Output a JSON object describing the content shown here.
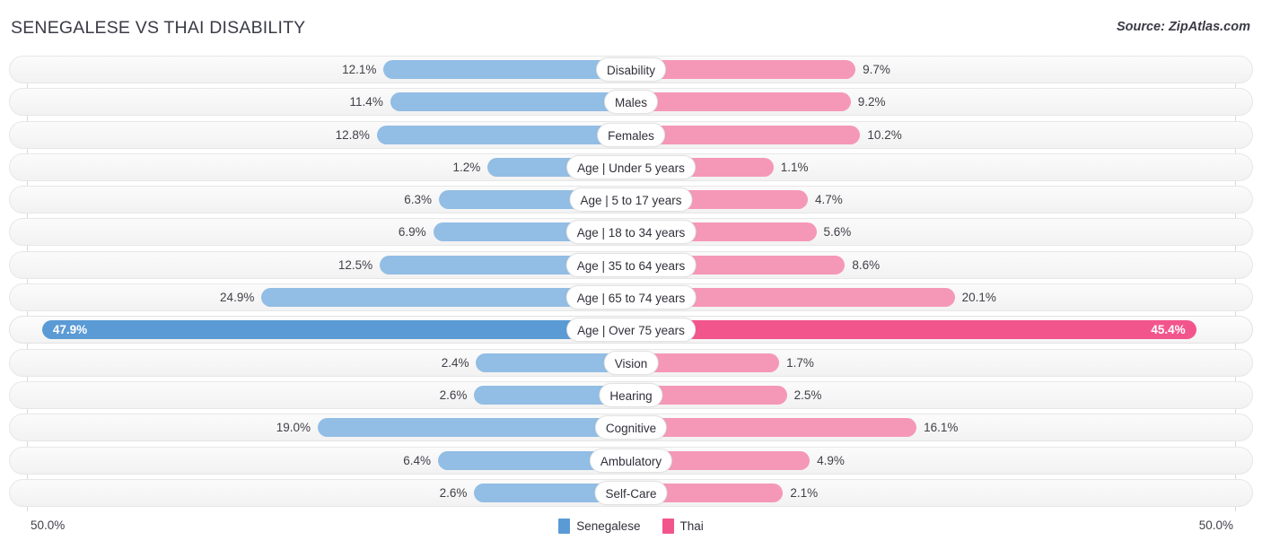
{
  "header": {
    "title": "SENEGALESE VS THAI DISABILITY",
    "source": "Source: ZipAtlas.com"
  },
  "axis": {
    "left_max_label": "50.0%",
    "right_max_label": "50.0%",
    "max_value": 50.0
  },
  "legend": {
    "items": [
      {
        "label": "Senegalese",
        "color": "#5B9BD5"
      },
      {
        "label": "Thai",
        "color": "#F2558C"
      }
    ]
  },
  "colors": {
    "left_bar": "#92BDE4",
    "right_bar": "#F598B8",
    "left_bar_highlight": "#5B9BD5",
    "right_bar_highlight": "#F2558C",
    "row_background": "#F7F7F7",
    "gridline": "#D9D9DE",
    "text": "#3F3F48"
  },
  "chart_data": {
    "type": "bar",
    "orientation": "horizontal-diverging",
    "title": "SENEGALESE VS THAI DISABILITY",
    "xlabel": "",
    "ylabel": "",
    "xlim": [
      50.0,
      50.0
    ],
    "grid": true,
    "legend_position": "bottom-center",
    "categories": [
      "Disability",
      "Males",
      "Females",
      "Age | Under 5 years",
      "Age | 5 to 17 years",
      "Age | 18 to 34 years",
      "Age | 35 to 64 years",
      "Age | 65 to 74 years",
      "Age | Over 75 years",
      "Vision",
      "Hearing",
      "Cognitive",
      "Ambulatory",
      "Self-Care"
    ],
    "series": [
      {
        "name": "Senegalese",
        "values": [
          12.1,
          11.4,
          12.8,
          1.2,
          6.3,
          6.9,
          12.5,
          24.9,
          47.9,
          2.4,
          2.6,
          19.0,
          6.4,
          2.6
        ]
      },
      {
        "name": "Thai",
        "values": [
          9.7,
          9.2,
          10.2,
          1.1,
          4.7,
          5.6,
          8.6,
          20.1,
          45.4,
          1.7,
          2.5,
          16.1,
          4.9,
          2.1
        ]
      }
    ]
  },
  "rows": [
    {
      "label": "Disability",
      "left_value": "12.1%",
      "right_value": "9.7%",
      "left_num": 12.1,
      "right_num": 9.7,
      "highlight": false
    },
    {
      "label": "Males",
      "left_value": "11.4%",
      "right_value": "9.2%",
      "left_num": 11.4,
      "right_num": 9.2,
      "highlight": false
    },
    {
      "label": "Females",
      "left_value": "12.8%",
      "right_value": "10.2%",
      "left_num": 12.8,
      "right_num": 10.2,
      "highlight": false
    },
    {
      "label": "Age | Under 5 years",
      "left_value": "1.2%",
      "right_value": "1.1%",
      "left_num": 1.2,
      "right_num": 1.1,
      "highlight": false
    },
    {
      "label": "Age | 5 to 17 years",
      "left_value": "6.3%",
      "right_value": "4.7%",
      "left_num": 6.3,
      "right_num": 4.7,
      "highlight": false
    },
    {
      "label": "Age | 18 to 34 years",
      "left_value": "6.9%",
      "right_value": "5.6%",
      "left_num": 6.9,
      "right_num": 5.6,
      "highlight": false
    },
    {
      "label": "Age | 35 to 64 years",
      "left_value": "12.5%",
      "right_value": "8.6%",
      "left_num": 12.5,
      "right_num": 8.6,
      "highlight": false
    },
    {
      "label": "Age | 65 to 74 years",
      "left_value": "24.9%",
      "right_value": "20.1%",
      "left_num": 24.9,
      "right_num": 20.1,
      "highlight": false
    },
    {
      "label": "Age | Over 75 years",
      "left_value": "47.9%",
      "right_value": "45.4%",
      "left_num": 47.9,
      "right_num": 45.4,
      "highlight": true
    },
    {
      "label": "Vision",
      "left_value": "2.4%",
      "right_value": "1.7%",
      "left_num": 2.4,
      "right_num": 1.7,
      "highlight": false
    },
    {
      "label": "Hearing",
      "left_value": "2.6%",
      "right_value": "2.5%",
      "left_num": 2.6,
      "right_num": 2.5,
      "highlight": false
    },
    {
      "label": "Cognitive",
      "left_value": "19.0%",
      "right_value": "16.1%",
      "left_num": 19.0,
      "right_num": 16.1,
      "highlight": false
    },
    {
      "label": "Ambulatory",
      "left_value": "6.4%",
      "right_value": "4.9%",
      "left_num": 6.4,
      "right_num": 4.9,
      "highlight": false
    },
    {
      "label": "Self-Care",
      "left_value": "2.6%",
      "right_value": "2.1%",
      "left_num": 2.6,
      "right_num": 2.1,
      "highlight": false
    }
  ]
}
